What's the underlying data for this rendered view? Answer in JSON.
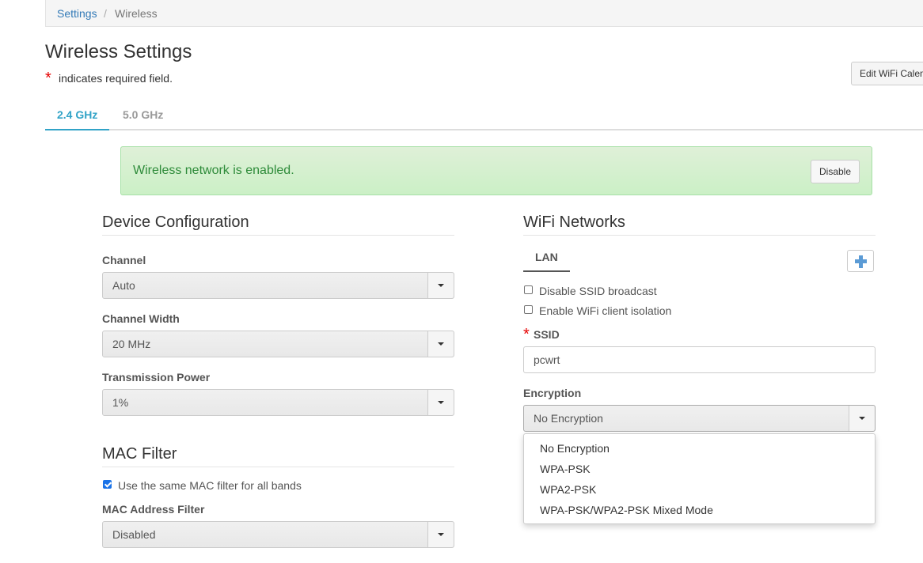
{
  "breadcrumb": {
    "items": [
      "Settings",
      "Wireless"
    ],
    "separator": "/"
  },
  "page": {
    "title": "Wireless Settings",
    "required_star": "*",
    "required_note": "indicates required field.",
    "edit_calendar_label": "Edit WiFi Calendar"
  },
  "tabs": [
    {
      "label": "2.4 GHz",
      "active": true
    },
    {
      "label": "5.0 GHz",
      "active": false
    }
  ],
  "alert": {
    "text": "Wireless network is enabled.",
    "button_label": "Disable"
  },
  "device_config": {
    "title": "Device Configuration",
    "channel": {
      "label": "Channel",
      "value": "Auto"
    },
    "channel_width": {
      "label": "Channel Width",
      "value": "20 MHz"
    },
    "tx_power": {
      "label": "Transmission Power",
      "value": "1%"
    }
  },
  "mac_filter": {
    "title": "MAC Filter",
    "same_filter_label": "Use the same MAC filter for all bands",
    "same_filter_checked": true,
    "address_filter": {
      "label": "MAC Address Filter",
      "value": "Disabled"
    }
  },
  "wifi_networks": {
    "title": "WiFi Networks",
    "network_tab": "LAN",
    "add_icon": "plus-icon",
    "disable_ssid_label": "Disable SSID broadcast",
    "disable_ssid_checked": false,
    "client_isolation_label": "Enable WiFi client isolation",
    "client_isolation_checked": false,
    "ssid": {
      "label": "SSID",
      "required_star": "*",
      "value": "pcwrt"
    },
    "encryption": {
      "label": "Encryption",
      "value": "No Encryption",
      "options": [
        "No Encryption",
        "WPA-PSK",
        "WPA2-PSK",
        "WPA-PSK/WPA2-PSK Mixed Mode"
      ]
    }
  },
  "colors": {
    "accent": "#31a3c7",
    "link": "#337ab7",
    "required": "#e60000",
    "success_text": "#2e8b3a",
    "success_bg": "#dff0d8"
  }
}
